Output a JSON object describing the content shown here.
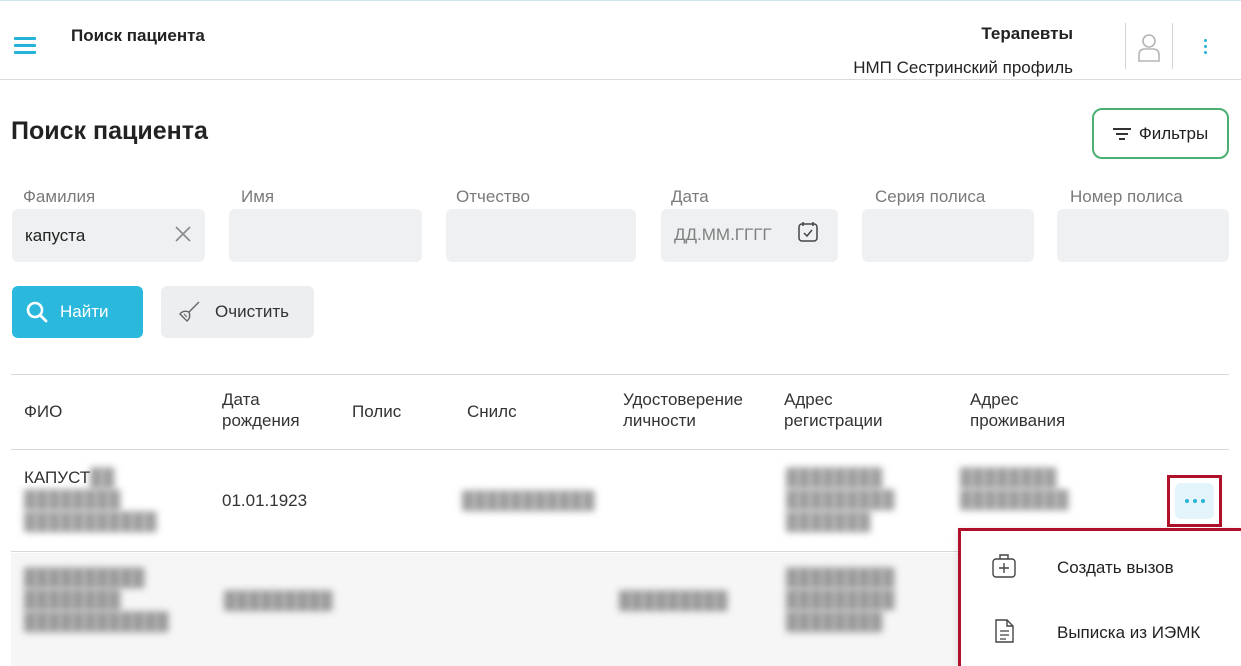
{
  "header": {
    "title": "Поиск пациента",
    "department": "Терапевты",
    "profile": "НМП Сестринский профиль",
    "menu_icon": "hamburger-menu-icon",
    "user_icon": "user-avatar-icon",
    "more_icon": "kebab-menu-icon"
  },
  "page": {
    "title": "Поиск пациента",
    "filters_label": "Фильтры"
  },
  "search": {
    "lastname": {
      "label": "Фамилия",
      "value": "капуста"
    },
    "firstname": {
      "label": "Имя",
      "value": ""
    },
    "patronymic": {
      "label": "Отчество",
      "value": ""
    },
    "date": {
      "label": "Дата",
      "placeholder": "ДД.ММ.ГГГГ"
    },
    "policy_series": {
      "label": "Серия полиса",
      "value": ""
    },
    "policy_number": {
      "label": "Номер полиса",
      "value": ""
    },
    "find_label": "Найти",
    "clear_label": "Очистить"
  },
  "table": {
    "columns": [
      "ФИО",
      "Дата рождения",
      "Полис",
      "Снилс",
      "Удостоверение личности",
      "Адрес регистрации",
      "Адрес проживания"
    ],
    "columns_split": {
      "fio": "ФИО",
      "dob_1": "Дата",
      "dob_2": "рождения",
      "policy": "Полис",
      "snils": "Снилс",
      "id_1": "Удостоверение",
      "id_2": "личности",
      "reg_1": "Адрес",
      "reg_2": "регистрации",
      "live_1": "Адрес",
      "live_2": "проживания"
    },
    "rows": [
      {
        "fio_1": "КАПУСТ",
        "dob": "01.01.1923"
      }
    ]
  },
  "row_menu": {
    "items": [
      {
        "label": "Создать вызов",
        "icon": "medkit-plus-icon"
      },
      {
        "label": "Выписка из ИЭМК",
        "icon": "document-icon"
      }
    ]
  },
  "colors": {
    "accent": "#2bb8dd",
    "filters_border": "#4caf73",
    "highlight_border": "#b0102a"
  }
}
